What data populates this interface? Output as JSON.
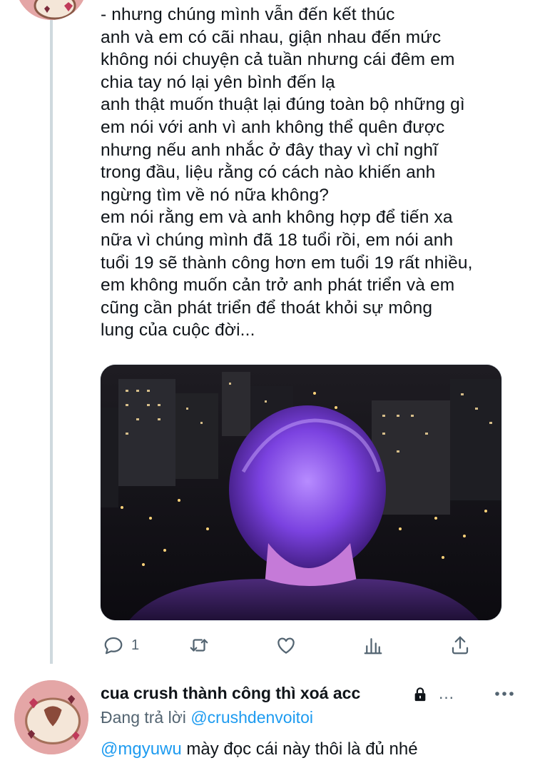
{
  "tweet": {
    "lines": [
      "- nhưng chúng mình vẫn đến kết thúc",
      "anh và em có cãi nhau, giận nhau đến mức",
      "không nói chuyện cả tuần nhưng cái đêm em",
      "chia tay nó lại yên bình đến lạ",
      "anh thật muốn thuật lại đúng toàn bộ những gì",
      "em nói với anh vì anh không thể quên được",
      "nhưng nếu anh nhắc ở đây thay vì chỉ nghĩ",
      "trong đầu, liệu rằng có cách nào khiến anh",
      "ngừng tìm về nó nữa không?",
      "em nói rằng em và anh không hợp để tiến xa",
      "nữa vì chúng mình đã 18 tuổi rồi, em nói anh",
      "tuổi 19 sẽ thành công hơn em tuổi 19 rất nhiều,",
      "em không muốn cản trở anh phát triển và em",
      "cũng cần phát triển để thoát khỏi sự mông",
      "lung của cuộc đời..."
    ],
    "reply_count": "1",
    "icons": [
      "reply-icon",
      "retweet-icon",
      "like-icon",
      "analytics-icon",
      "share-icon"
    ]
  },
  "reply": {
    "display_name": "cua crush thành công thì xoá acc",
    "name_ellipsis": "…",
    "replying_prefix": "Đang trả lời",
    "replying_handle": "@crushdenvoitoi",
    "mention": "@mgyuwu",
    "text": " mày đọc cái này thôi là đủ nhé",
    "icons": [
      "lock-icon",
      "more-icon"
    ]
  },
  "colors": {
    "accent": "#1d9bf0",
    "secondary_text": "#536471",
    "thread_line": "#cfd9de",
    "avatar_bg": "#e9a9a9"
  }
}
